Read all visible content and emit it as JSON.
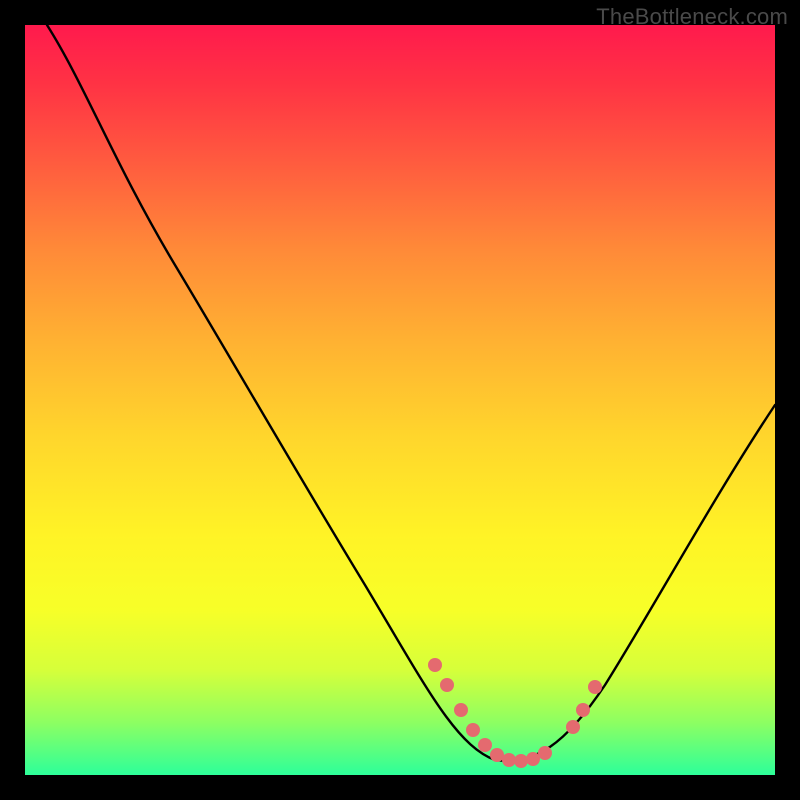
{
  "watermark": "TheBottleneck.com",
  "chart_data": {
    "type": "line",
    "title": "",
    "xlabel": "",
    "ylabel": "",
    "xlim": [
      0,
      100
    ],
    "ylim": [
      0,
      100
    ],
    "series": [
      {
        "name": "bottleneck-curve",
        "x": [
          3,
          8,
          15,
          22,
          30,
          38,
          46,
          52,
          56,
          58,
          60,
          62,
          64,
          66,
          68,
          70,
          72,
          75,
          80,
          86,
          92,
          100
        ],
        "y": [
          100,
          92,
          81,
          70,
          57,
          44,
          31,
          20,
          12,
          9,
          6,
          4,
          3,
          2,
          2,
          3,
          4,
          6,
          12,
          22,
          33,
          48
        ]
      }
    ],
    "markers": {
      "name": "highlight-dots",
      "x": [
        55,
        56.5,
        58,
        59.5,
        61,
        62.5,
        64,
        65.5,
        67,
        68.5,
        72,
        73.5,
        75
      ],
      "y": [
        14,
        11,
        9,
        7,
        5,
        4,
        3,
        3,
        3,
        3,
        4,
        6,
        8
      ]
    }
  }
}
